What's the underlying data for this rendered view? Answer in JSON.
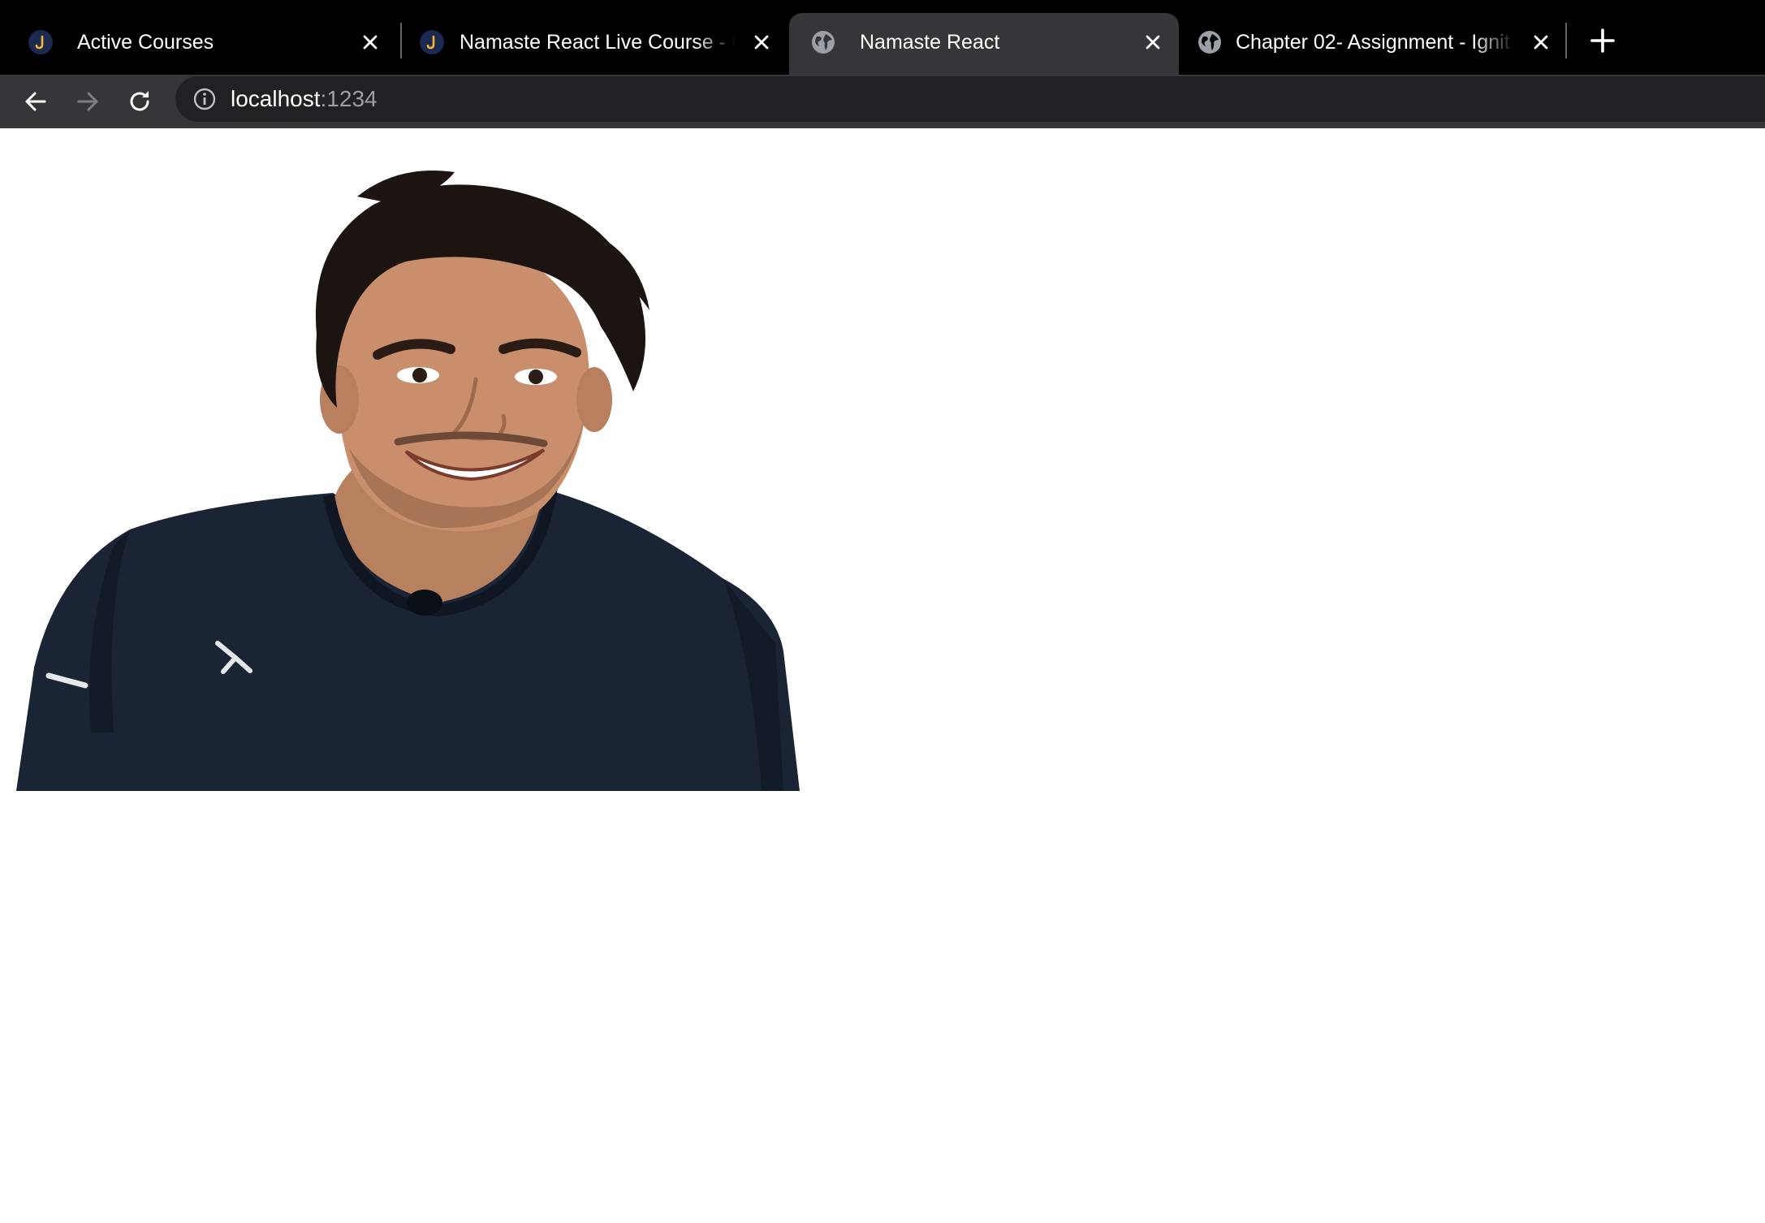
{
  "browser": {
    "tabs": [
      {
        "title": "Active Courses",
        "favicon": "course-site-favicon",
        "active": false
      },
      {
        "title": "Namaste React Live Course - C",
        "favicon": "course-site-favicon",
        "active": false
      },
      {
        "title": "Namaste React",
        "favicon": "globe-icon",
        "active": true
      },
      {
        "title": "Chapter 02- Assignment - Ignit",
        "favicon": "globe-icon",
        "active": false
      }
    ],
    "new_tab_icon": "plus-icon",
    "nav": {
      "back": "arrow-left-icon",
      "forward": "arrow-right-icon",
      "reload": "reload-icon"
    },
    "address_bar": {
      "host": "localhost",
      "port": ":1234",
      "security_icon": "info-circle-icon"
    }
  },
  "page": {
    "image": {
      "subject": "portrait-photo",
      "alt": ""
    }
  },
  "colors": {
    "tabstrip": "#000000",
    "active_tab": "#35363a",
    "toolbar": "#35363a",
    "omnibox": "#202124",
    "shirt": "#1b2434",
    "hair": "#1c1410",
    "skin": "#c98f6d"
  }
}
